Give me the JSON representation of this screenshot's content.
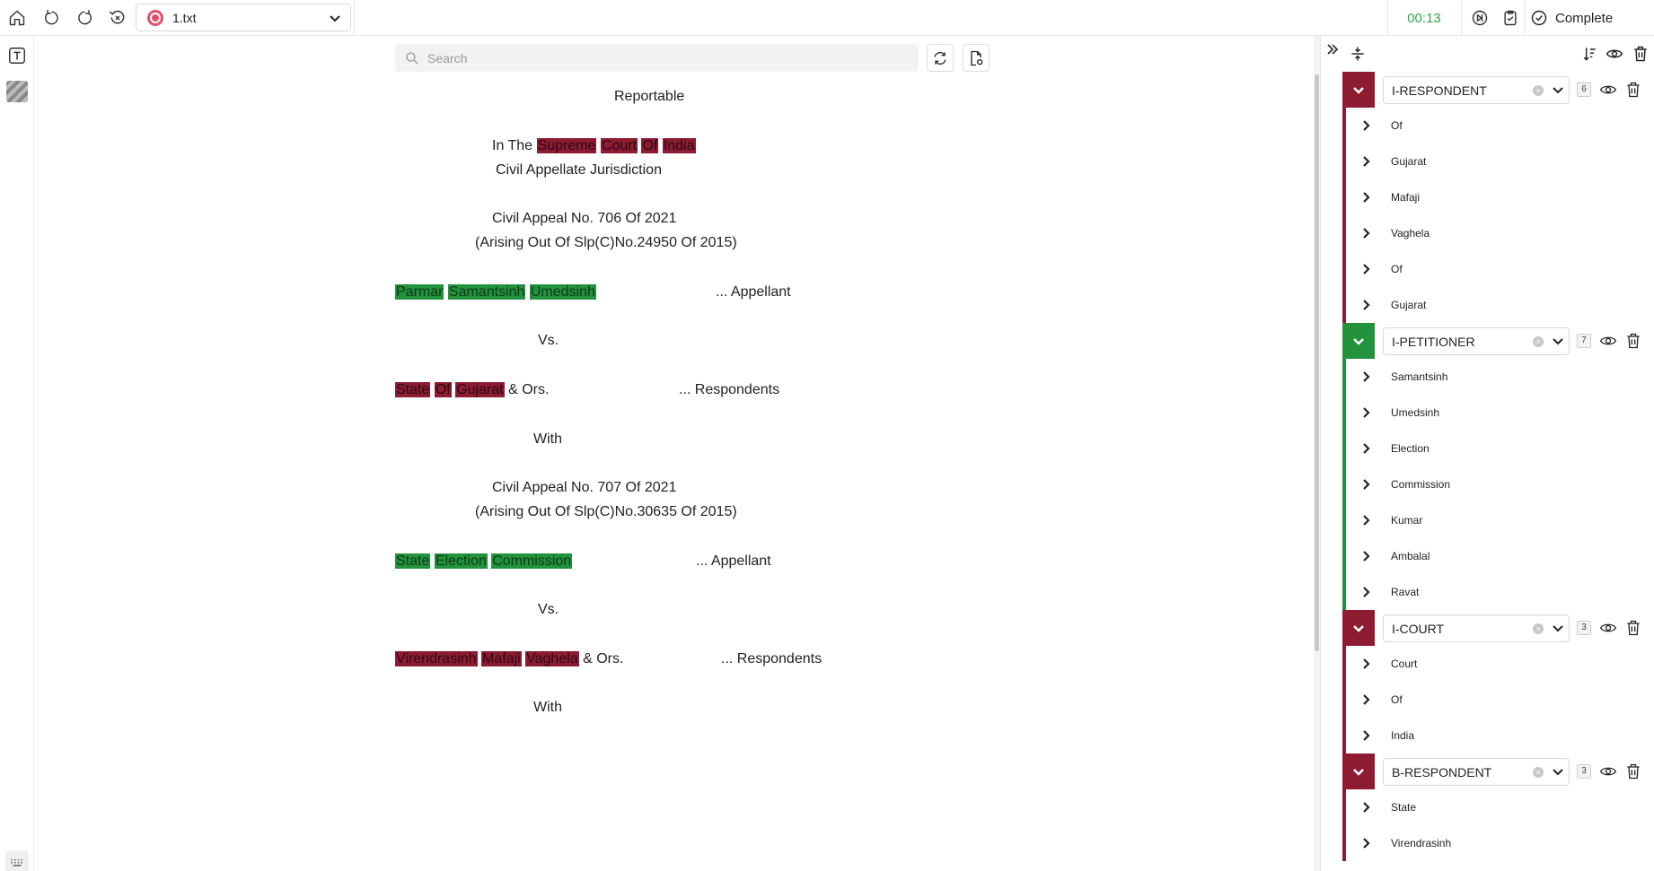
{
  "topbar": {
    "file_name": "1.txt",
    "timer": "00:13",
    "complete_label": "Complete"
  },
  "search": {
    "placeholder": "Search"
  },
  "document": {
    "lines": [
      {
        "tokens": [
          {
            "t": "Reportable"
          }
        ]
      },
      {
        "tokens": [
          {
            "t": "In The "
          },
          {
            "t": "Supreme",
            "hl": "red"
          },
          {
            "t": " "
          },
          {
            "t": "Court",
            "hl": "red"
          },
          {
            "t": " "
          },
          {
            "t": "Of",
            "hl": "red"
          },
          {
            "t": " "
          },
          {
            "t": "India",
            "hl": "red"
          }
        ]
      },
      {
        "tokens": [
          {
            "t": "Civil Appellate Jurisdiction"
          }
        ]
      },
      {
        "tokens": [
          {
            "t": "Civil Appeal No. 706 Of 2021"
          }
        ]
      },
      {
        "tokens": [
          {
            "t": "(Arising Out Of Slp(C)No.24950 Of 2015)"
          }
        ]
      },
      {
        "tokens": [
          {
            "t": "Parmar",
            "hl": "green"
          },
          {
            "t": " "
          },
          {
            "t": "Samantsinh",
            "hl": "green"
          },
          {
            "t": " "
          },
          {
            "t": "Umedsinh",
            "hl": "green"
          }
        ]
      },
      {
        "tokens": [
          {
            "t": "... Appellant"
          }
        ]
      },
      {
        "tokens": [
          {
            "t": "Vs."
          }
        ]
      },
      {
        "tokens": [
          {
            "t": "State",
            "hl": "red"
          },
          {
            "t": " "
          },
          {
            "t": "Of",
            "hl": "red"
          },
          {
            "t": " "
          },
          {
            "t": "Gujarat",
            "hl": "red"
          },
          {
            "t": " & Ors."
          }
        ]
      },
      {
        "tokens": [
          {
            "t": "... Respondents"
          }
        ]
      },
      {
        "tokens": [
          {
            "t": "With"
          }
        ]
      },
      {
        "tokens": [
          {
            "t": "Civil Appeal No. 707 Of 2021"
          }
        ]
      },
      {
        "tokens": [
          {
            "t": "(Arising Out Of Slp(C)No.30635 Of 2015)"
          }
        ]
      },
      {
        "tokens": [
          {
            "t": "State",
            "hl": "green"
          },
          {
            "t": " "
          },
          {
            "t": "Election",
            "hl": "green"
          },
          {
            "t": " "
          },
          {
            "t": "Commission",
            "hl": "green"
          }
        ]
      },
      {
        "tokens": [
          {
            "t": "... Appellant"
          }
        ]
      },
      {
        "tokens": [
          {
            "t": "Vs."
          }
        ]
      },
      {
        "tokens": [
          {
            "t": "Virendrasinh",
            "hl": "red"
          },
          {
            "t": " "
          },
          {
            "t": "Mafaji",
            "hl": "red"
          },
          {
            "t": " "
          },
          {
            "t": "Vaghela",
            "hl": "red"
          },
          {
            "t": " & Ors."
          }
        ]
      },
      {
        "tokens": [
          {
            "t": "... Respondents"
          }
        ]
      },
      {
        "tokens": [
          {
            "t": "With"
          }
        ]
      }
    ]
  },
  "entities": [
    {
      "label": "I-RESPONDENT",
      "count": "6",
      "color": "#8d1c33",
      "items": [
        "Of",
        "Gujarat",
        "Mafaji",
        "Vaghela",
        "Of",
        "Gujarat"
      ]
    },
    {
      "label": "I-PETITIONER",
      "count": "7",
      "color": "#23923d",
      "items": [
        "Samantsinh",
        "Umedsinh",
        "Election",
        "Commission",
        "Kumar",
        "Ambalal",
        "Ravat"
      ]
    },
    {
      "label": "I-COURT",
      "count": "3",
      "color": "#8d1c33",
      "items": [
        "Court",
        "Of",
        "India"
      ]
    },
    {
      "label": "B-RESPONDENT",
      "count": "3",
      "color": "#8d1c33",
      "items": [
        "State",
        "Virendrasinh"
      ]
    }
  ],
  "colors": {
    "accent_green": "#2fa84f",
    "highlight_red": "#8d1c33",
    "highlight_green": "#23923d"
  }
}
